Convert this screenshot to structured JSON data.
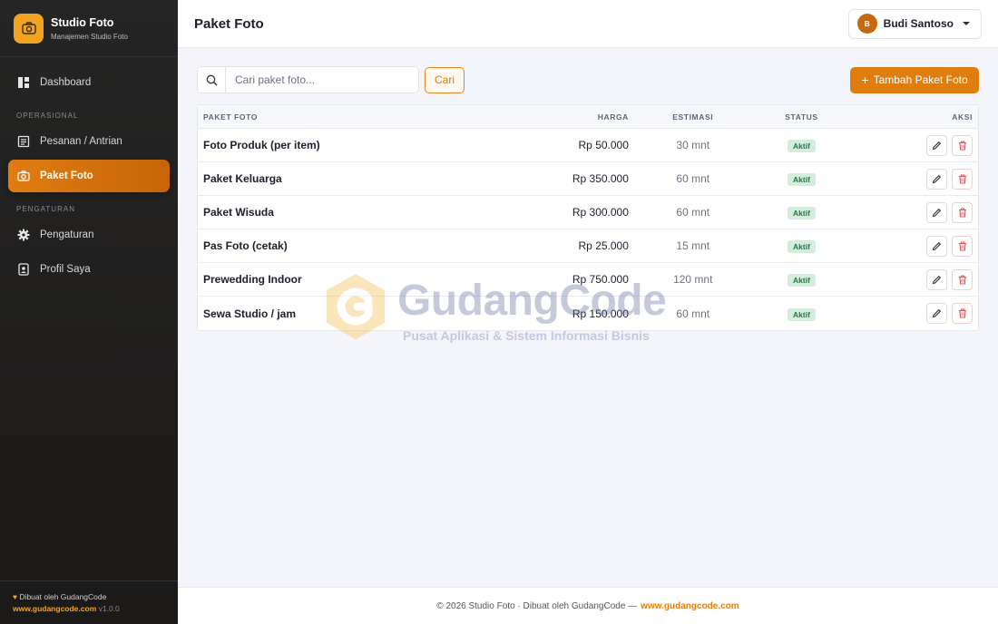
{
  "sidebar": {
    "brand_name": "Studio Foto",
    "brand_subtitle": "Manajemen Studio Foto",
    "items": [
      {
        "label": "Dashboard",
        "icon": "dashboard-icon"
      },
      {
        "label": "Pesanan / Antrian",
        "icon": "list-icon"
      },
      {
        "label": "Paket Foto",
        "icon": "camera-icon",
        "active": true
      },
      {
        "label": "Pengaturan",
        "icon": "gear-icon"
      },
      {
        "label": "Profil Saya",
        "icon": "id-badge-icon"
      }
    ],
    "sections": {
      "operasional": "OPERASIONAL",
      "pengaturan": "PENGATURAN"
    },
    "footer_credit": "Dibuat oleh GudangCode",
    "footer_url": "www.gudangcode.com",
    "footer_version": "v1.0.0"
  },
  "topbar": {
    "title": "Paket Foto",
    "user_initial": "B",
    "user_name": "Budi Santoso"
  },
  "toolbar": {
    "search_placeholder": "Cari paket foto...",
    "search_button": "Cari",
    "add_button": "Tambah Paket Foto"
  },
  "table": {
    "headers": {
      "name": "PAKET FOTO",
      "price": "HARGA",
      "estimate": "ESTIMASI",
      "status": "STATUS",
      "actions": "AKSI"
    },
    "rows": [
      {
        "name": "Foto Produk (per item)",
        "price": "Rp 50.000",
        "estimate": "30 mnt",
        "status": "Aktif"
      },
      {
        "name": "Paket Keluarga",
        "price": "Rp 350.000",
        "estimate": "60 mnt",
        "status": "Aktif"
      },
      {
        "name": "Paket Wisuda",
        "price": "Rp 300.000",
        "estimate": "60 mnt",
        "status": "Aktif"
      },
      {
        "name": "Pas Foto (cetak)",
        "price": "Rp 25.000",
        "estimate": "15 mnt",
        "status": "Aktif"
      },
      {
        "name": "Prewedding Indoor",
        "price": "Rp 750.000",
        "estimate": "120 mnt",
        "status": "Aktif"
      },
      {
        "name": "Sewa Studio / jam",
        "price": "Rp 150.000",
        "estimate": "60 mnt",
        "status": "Aktif"
      }
    ]
  },
  "watermark": {
    "title": "GudangCode",
    "subtitle": "Pusat Aplikasi & Sistem Informasi Bisnis"
  },
  "footer": {
    "text": "© 2026 Studio Foto · Dibuat oleh GudangCode —",
    "link": "www.gudangcode.com"
  },
  "colors": {
    "accent": "#e07d10",
    "sidebar_bg": "#1f1d1b",
    "brand_logo": "#f0a421",
    "badge_bg": "#d4ecdc",
    "badge_text": "#1f7a45",
    "delete_icon": "#e05454"
  }
}
